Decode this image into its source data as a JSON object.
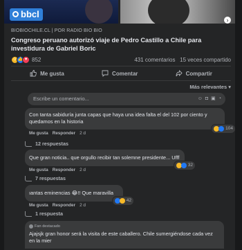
{
  "post": {
    "image_badge": "bbcl",
    "source": "BIOBIOCHILE.CL | POR RADIO BIO BIO",
    "headline": "Congreso peruano autorizó viaje de Pedro Castillo a Chile para investidura de Gabriel Boric",
    "reactions_count": "852",
    "comments_count": "431 comentarios",
    "shares_count": "15 veces compartido"
  },
  "actions": {
    "like": "Me gusta",
    "comment": "Comentar",
    "share": "Compartir"
  },
  "filter": "Más relevantes ▾",
  "comment_input": {
    "placeholder": "Escribe un comentario..."
  },
  "comments": [
    {
      "text": "Con tanta sabiduría junta capas que haya una idea falta el del 102 por ciento y quedamos en la historia",
      "like": "Me gusta",
      "reply": "Responder",
      "time": "2 d",
      "reaction_count": "104",
      "replies_label": "12 respuestas"
    },
    {
      "text": "Que gran noticia.. que orgullo recibir tan solemne presidente... Ufff",
      "like": "Me gusta",
      "reply": "Responder",
      "time": "2 d",
      "reaction_count": "32",
      "replies_label": "7 respuestas"
    },
    {
      "text": "ıantas eminencias 😂!! Que maravilla",
      "like": "Me gusta",
      "reply": "Responder",
      "time": "2 d",
      "reaction_count": "42",
      "replies_label": "1 respuesta"
    },
    {
      "badge": "Fan destacado",
      "text": "Ajajsjk gran honor será la visita de este caballero. Chile sumergiéndose cada vez en la mier"
    }
  ],
  "colors": {
    "background": "#18191a",
    "card": "#242526",
    "bubble": "#3a3b3c",
    "text": "#e4e6eb",
    "muted": "#b0b3b8",
    "like_blue": "#2078f4",
    "haha_yellow": "#f7b928",
    "love_red": "#f33e58"
  }
}
